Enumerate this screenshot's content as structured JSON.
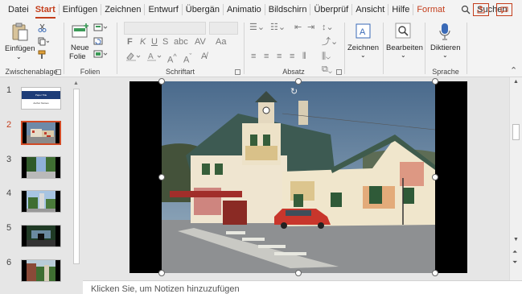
{
  "tabs": [
    "Datei",
    "Start",
    "Einfügen",
    "Zeichnen",
    "Entwurf",
    "Übergän",
    "Animatio",
    "Bildschirn",
    "Überprüf",
    "Ansicht",
    "Hilfe",
    "Format"
  ],
  "active_tab": "Start",
  "search": {
    "label": "Suchen"
  },
  "ribbon": {
    "clipboard": {
      "paste": "Einfügen",
      "group": "Zwischenablage"
    },
    "slides": {
      "new_slide_line1": "Neue",
      "new_slide_line2": "Folie",
      "group": "Folien"
    },
    "font": {
      "bold": "F",
      "italic": "K",
      "underline": "U",
      "strike": "S",
      "group": "Schriftart"
    },
    "paragraph": {
      "group": "Absatz"
    },
    "drawing": {
      "label": "Zeichnen"
    },
    "editing": {
      "label": "Bearbeiten"
    },
    "voice": {
      "label": "Diktieren",
      "group": "Sprache"
    }
  },
  "slides": [
    {
      "num": "1",
      "title": "Paper Title",
      "subtitle": "Author Names"
    },
    {
      "num": "2"
    },
    {
      "num": "3"
    },
    {
      "num": "4"
    },
    {
      "num": "5"
    },
    {
      "num": "6"
    }
  ],
  "selected_slide": "2",
  "notes": {
    "placeholder": "Klicken Sie, um Notizen hinzuzufügen"
  },
  "colors": {
    "accent": "#c43e1c",
    "ribbon_bg": "#f3f3f3",
    "workspace_bg": "#e6e6e6",
    "selection": "#d04a25"
  },
  "icons": [
    "search-icon",
    "share-icon",
    "comment-icon",
    "paste-icon",
    "cut-icon",
    "copy-icon",
    "format-painter-icon",
    "new-slide-icon",
    "layout-icon",
    "reset-icon",
    "section-icon",
    "drawing-icon",
    "search-replace-icon",
    "microphone-icon",
    "scroll-up-icon",
    "scroll-down-icon",
    "previous-slide-icon",
    "next-slide-icon",
    "ribbon-collapse-icon"
  ]
}
